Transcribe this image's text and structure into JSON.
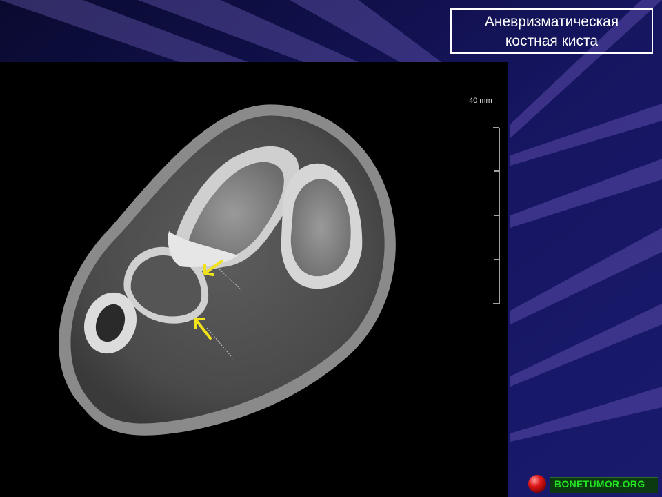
{
  "slide": {
    "title_line1": "Аневризматическая",
    "title_line2": "костная киста",
    "background_color": "#0c0c3a",
    "title_border_color": "#ffffff"
  },
  "image": {
    "scale_label": "40 mm",
    "arrow_color": "#f2e21a",
    "arrow_count": 2
  },
  "brand": {
    "text": "BONETUMOR.ORG",
    "text_color": "#22e222",
    "bar_color": "#0b3a10",
    "ball_color": "#e01818"
  }
}
